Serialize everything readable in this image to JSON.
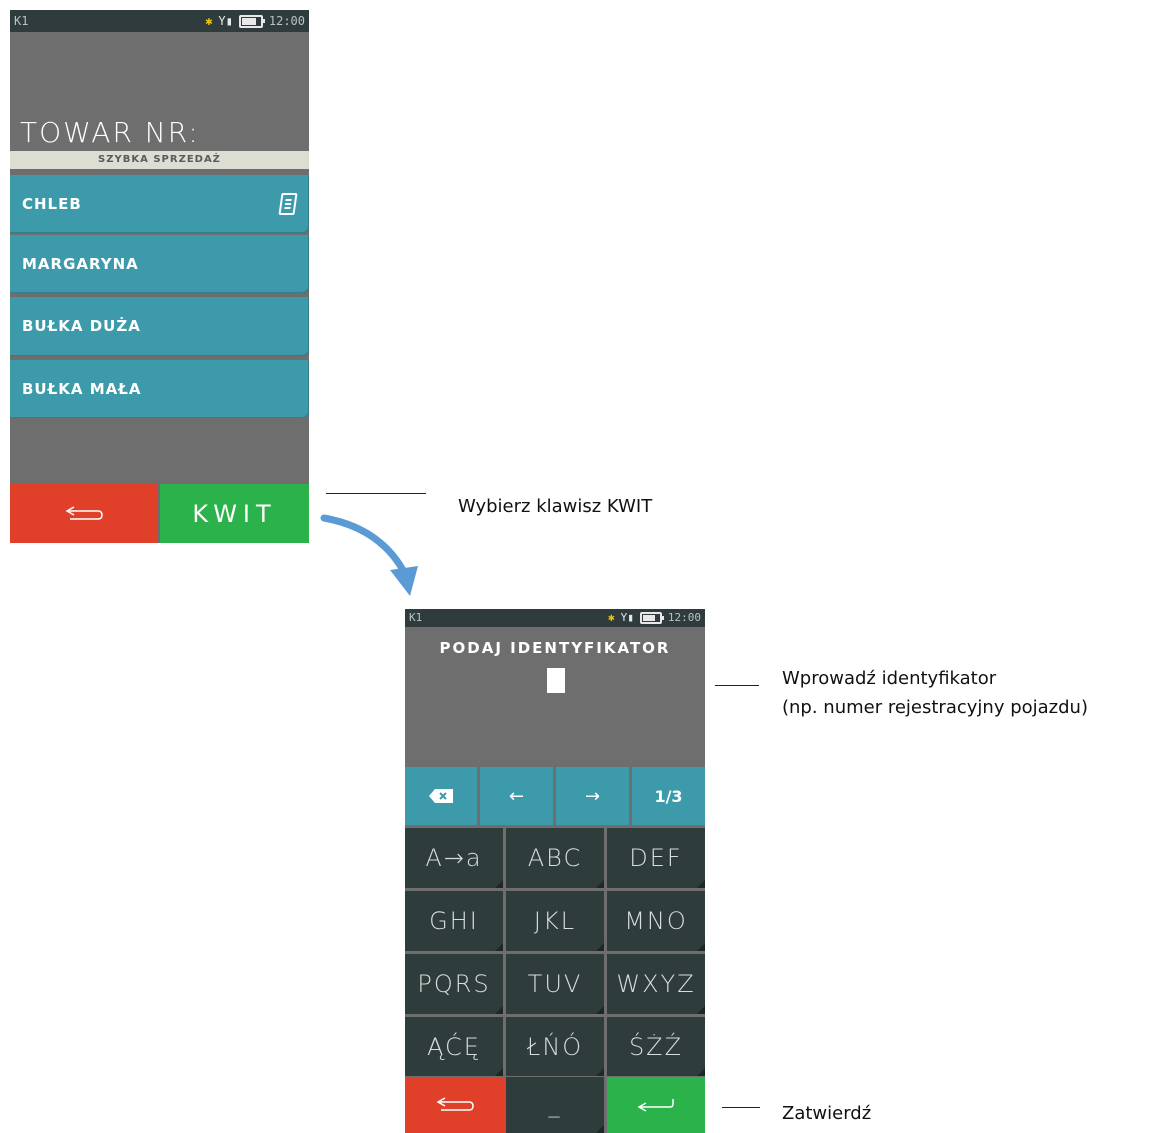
{
  "screen1": {
    "status": {
      "k": "K1",
      "time": "12:00"
    },
    "prompt": "TOWAR NR:",
    "section_title": "SZYBKA SPRZEDAŻ",
    "items": [
      "CHLEB",
      "MARGARYNA",
      "BUŁKA DUŻA",
      "BUŁKA MAŁA"
    ],
    "kwit_label": "KWIT"
  },
  "annotation1": "Wybierz klawisz KWIT",
  "screen2": {
    "status": {
      "k": "K1",
      "time": "12:00"
    },
    "prompt": "PODAJ IDENTYFIKATOR",
    "page_indicator": "1/3",
    "keys": [
      "A→a",
      "ABC",
      "DEF",
      "GHI",
      "JKL",
      "MNO",
      "PQRS",
      "TUV",
      "WXYZ",
      "ĄĆĘ",
      "ŁŃÓ",
      "ŚŻŹ"
    ],
    "space_label": "_"
  },
  "annotation2_line1": "Wprowadź identyfikator",
  "annotation2_line2": "(np. numer rejestracyjny pojazdu)",
  "annotation3": "Zatwierdź",
  "colors": {
    "accent_teal": "#3d9aab",
    "red": "#e0402a",
    "green": "#2bb24a",
    "arrow_blue": "#5b9bd5"
  }
}
